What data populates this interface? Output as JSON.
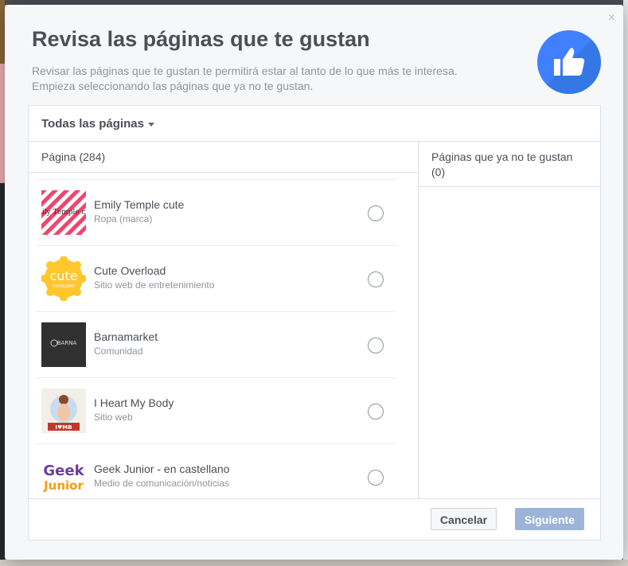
{
  "dialog": {
    "close_label": "×",
    "title": "Revisa las páginas que te gustan",
    "description_line1": "Revisar las páginas que te gustan te permitirá estar al tanto de lo que más te interesa.",
    "description_line2": "Empieza seleccionando las páginas que ya no te gustan."
  },
  "filter": {
    "label": "Todas las páginas"
  },
  "left_column": {
    "header": "Página (284)"
  },
  "right_column": {
    "header_line1": "Páginas que ya no te gustan",
    "header_line2": "(0)"
  },
  "pages": [
    {
      "name": "Emily Temple cute",
      "category": "Ropa (marca)",
      "thumb_text": "Emily Temple cute"
    },
    {
      "name": "Cute Overload",
      "category": "Sitio web de entretenimiento",
      "thumb_text": "cute",
      "thumb_sub": "OVERLOAD"
    },
    {
      "name": "Barnamarket",
      "category": "Comunidad",
      "thumb_text": "BARNA"
    },
    {
      "name": "I Heart My Body",
      "category": "Sitio web",
      "thumb_text": "I♥MB"
    },
    {
      "name": "Geek Junior - en castellano",
      "category": "Medio de comunicación/noticias",
      "thumb_text": "Geek",
      "thumb_sub": "Junior"
    }
  ],
  "footer": {
    "cancel_label": "Cancelar",
    "next_label": "Siguiente"
  },
  "colors": {
    "accent": "#4080ff",
    "next_button_disabled": "#9cb4d8"
  }
}
